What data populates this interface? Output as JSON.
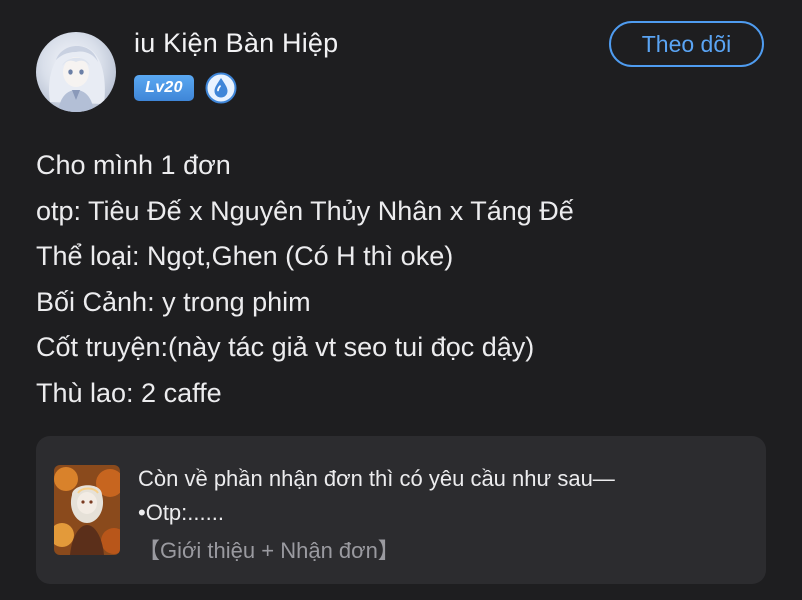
{
  "author": {
    "name": "iu Kiện Bàn Hiệp",
    "level": "Lv20",
    "avatar_icon": "anime-character-avatar",
    "rank_icon": "water-drop-rank-badge-icon"
  },
  "follow_button": {
    "label": "Theo dõi",
    "color": "#4f9cf0"
  },
  "post": {
    "lines": [
      "Cho mình 1 đơn",
      "otp: Tiêu Đế x Nguyên Thủy Nhân x Táng Đế",
      "Thể loại: Ngọt,Ghen (Có H thì oke)",
      "Bối Cảnh: y trong phim",
      "Cốt truyện:(này tác giả vt seo tui đọc dậy)",
      "Thù lao: 2 caffe"
    ]
  },
  "linked_post": {
    "thumbnail_icon": "autumn-illustration-thumbnail",
    "line1": "Còn về phần nhận đơn thì có yêu cầu như sau—",
    "line2": "•Otp:......",
    "tag": "【Giới thiệu + Nhận đơn】"
  },
  "colors": {
    "background": "#1e1e20",
    "card_background": "#2c2c2f",
    "accent": "#4f9cf0",
    "text": "#ececee",
    "muted_text": "#9a9aa0"
  }
}
